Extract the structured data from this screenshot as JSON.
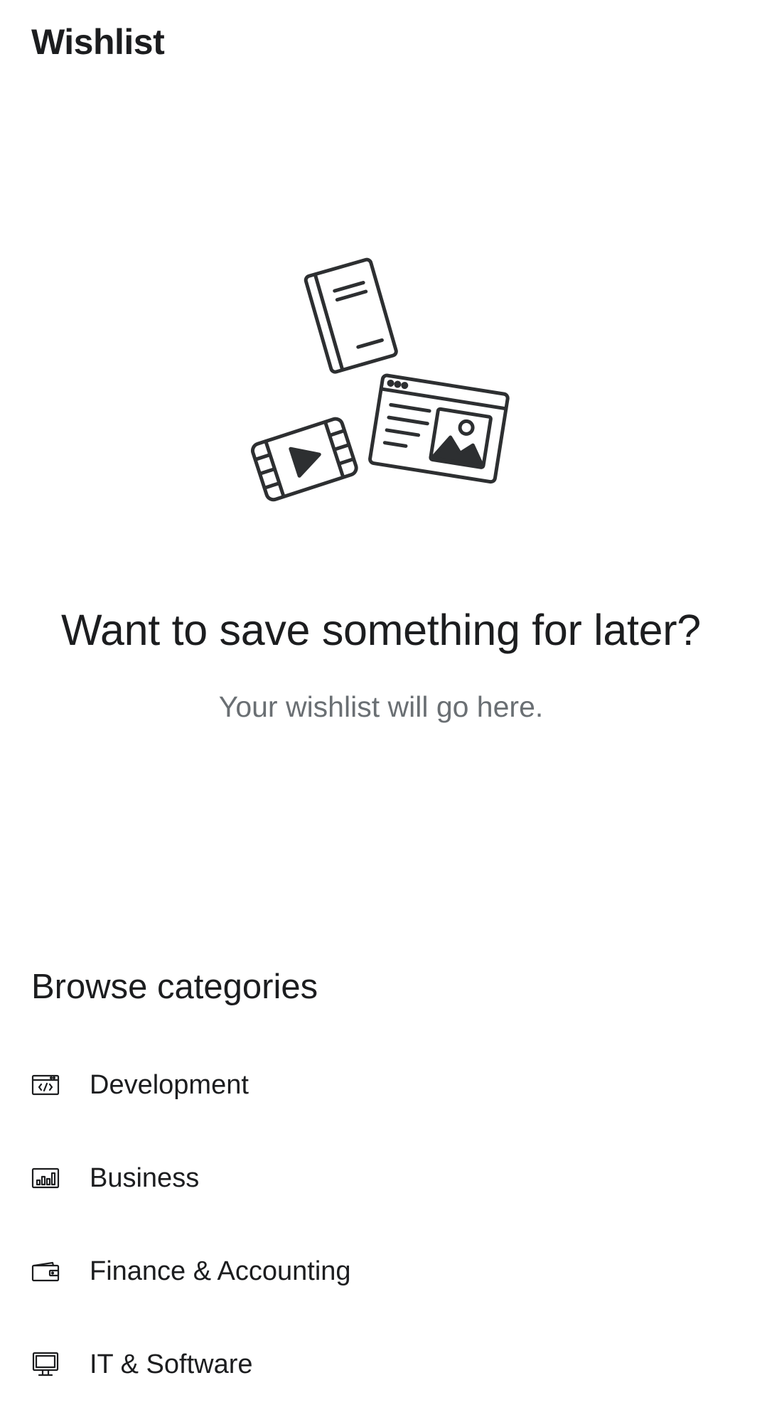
{
  "header": {
    "title": "Wishlist"
  },
  "empty_state": {
    "illustration_icon": "saved-items-illustration",
    "title": "Want to save something for later?",
    "subtitle": "Your wishlist will go here."
  },
  "browse": {
    "title": "Browse categories",
    "categories": [
      {
        "label": "Development",
        "icon": "code-window-icon"
      },
      {
        "label": "Business",
        "icon": "bar-chart-icon"
      },
      {
        "label": "Finance & Accounting",
        "icon": "wallet-icon"
      },
      {
        "label": "IT & Software",
        "icon": "monitor-icon"
      }
    ]
  }
}
